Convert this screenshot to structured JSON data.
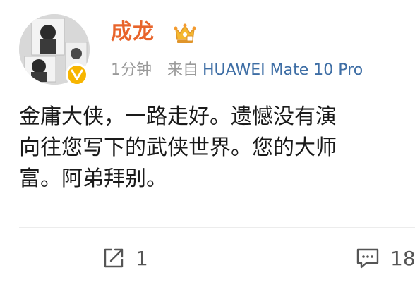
{
  "post": {
    "author": "成龙",
    "time": "1分钟",
    "source_prefix": "来自",
    "source_device": "HUAWEI Mate 10 Pro",
    "content_lines": [
      "金庸大侠，一路走好。遗憾没有演",
      "向往您写下的武侠世界。您的大师",
      "富。阿弟拜别。"
    ]
  },
  "actions": {
    "repost_count": "1",
    "comment_count": "18"
  },
  "colors": {
    "author_name": "#e8642b",
    "device_link": "#3e6ea5",
    "meta_gray": "#9a9a9a",
    "verified_badge": "#f7b500"
  },
  "icons": {
    "verified": "verified-v-icon",
    "vip": "crown-icon",
    "repost": "share-icon",
    "comment": "comment-icon"
  }
}
